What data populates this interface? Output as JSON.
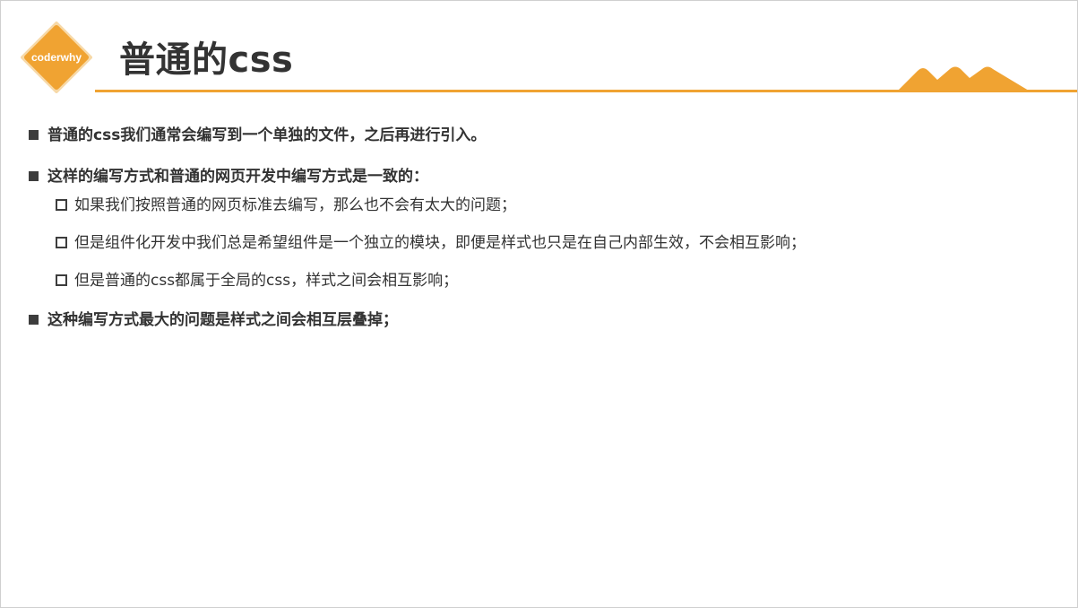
{
  "header": {
    "logo_text": "coderwhy",
    "title": "普通的css"
  },
  "colors": {
    "accent": "#f0a332",
    "text": "#333333",
    "logo_fill": "#f0a332",
    "logo_ring": "#f7d9a8"
  },
  "content": {
    "bullets": [
      {
        "text": "普通的css我们通常会编写到一个单独的文件，之后再进行引入。"
      },
      {
        "text": "这样的编写方式和普通的网页开发中编写方式是一致的：",
        "sub": [
          "如果我们按照普通的网页标准去编写，那么也不会有太大的问题；",
          "但是组件化开发中我们总是希望组件是一个独立的模块，即便是样式也只是在自己内部生效，不会相互影响；",
          "但是普通的css都属于全局的css，样式之间会相互影响；"
        ]
      },
      {
        "text": "这种编写方式最大的问题是样式之间会相互层叠掉；"
      }
    ]
  }
}
